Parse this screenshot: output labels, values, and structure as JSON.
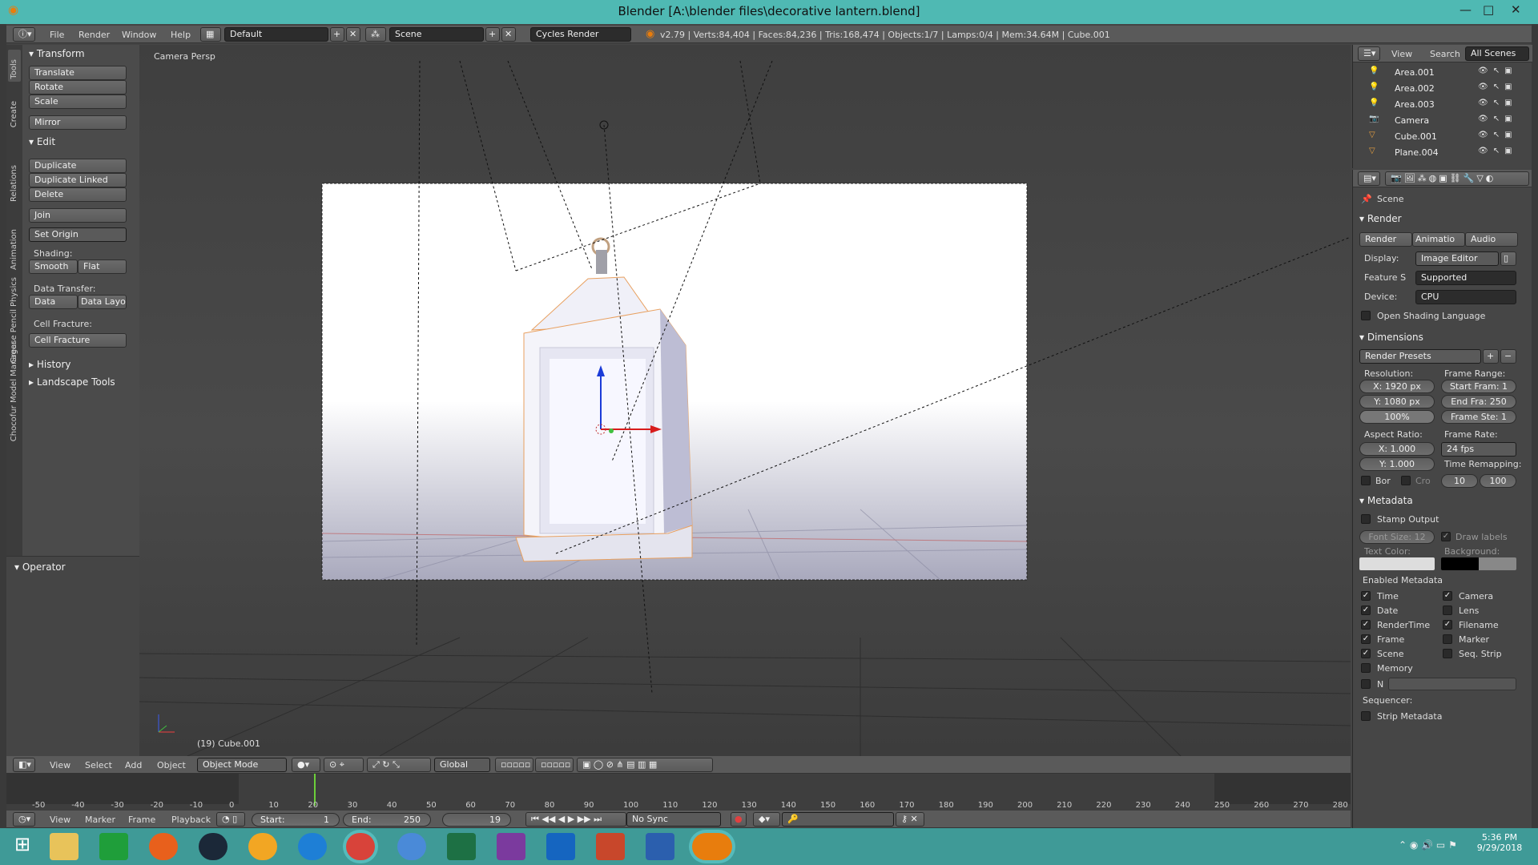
{
  "window": {
    "title": "Blender [A:\\blender files\\decorative lantern.blend]",
    "min": "—",
    "max": "□",
    "close": "✕"
  },
  "menu": {
    "file": "File",
    "render": "Render",
    "window": "Window",
    "help": "Help",
    "layout": "Default",
    "scene": "Scene",
    "engine": "Cycles Render",
    "stats": "v2.79 | Verts:84,404 | Faces:84,236 | Tris:168,474 | Objects:1/7 | Lamps:0/4 | Mem:34.64M | Cube.001"
  },
  "tabs": [
    "Tools",
    "Create",
    "Relations",
    "Animation",
    "Physics",
    "Grease Pencil",
    "Chocofur Model Manager"
  ],
  "toolshelf": {
    "transform": "Transform",
    "translate": "Translate",
    "rotate": "Rotate",
    "scale": "Scale",
    "mirror": "Mirror",
    "edit": "Edit",
    "duplicate": "Duplicate",
    "duplicate_linked": "Duplicate Linked",
    "delete": "Delete",
    "join": "Join",
    "set_origin": "Set Origin",
    "shading": "Shading:",
    "smooth": "Smooth",
    "flat": "Flat",
    "data_transfer": "Data Transfer:",
    "data": "Data",
    "data_layo": "Data Layo",
    "cell_fracture_lbl": "Cell Fracture:",
    "cell_fracture": "Cell Fracture",
    "history": "History",
    "landscape": "Landscape Tools",
    "operator": "Operator"
  },
  "viewport": {
    "label": "Camera Persp",
    "object": "(19) Cube.001"
  },
  "view_header": {
    "view": "View",
    "select": "Select",
    "add": "Add",
    "object": "Object",
    "mode": "Object Mode",
    "orient": "Global"
  },
  "timeline": {
    "ticks": [
      "-50",
      "-40",
      "-30",
      "-20",
      "-10",
      "0",
      "10",
      "20",
      "30",
      "40",
      "50",
      "60",
      "70",
      "80",
      "90",
      "100",
      "110",
      "120",
      "130",
      "140",
      "150",
      "160",
      "170",
      "180",
      "190",
      "200",
      "210",
      "220",
      "230",
      "240",
      "250",
      "260",
      "270",
      "280"
    ],
    "view": "View",
    "marker": "Marker",
    "frame": "Frame",
    "playback": "Playback",
    "start": "Start:",
    "start_val": "1",
    "end": "End:",
    "end_val": "250",
    "current": "19",
    "sync": "No Sync",
    "current_frame": 19
  },
  "outliner": {
    "view": "View",
    "search": "Search",
    "all_scenes": "All Scenes",
    "items": [
      "Area.001",
      "Area.002",
      "Area.003",
      "Camera",
      "Cube.001",
      "Plane.004"
    ]
  },
  "props": {
    "scene": "Scene",
    "render": "Render",
    "render_btn": "Render",
    "anim_btn": "Animatio",
    "audio_btn": "Audio",
    "display_lbl": "Display:",
    "display": "Image Editor",
    "feature_lbl": "Feature S",
    "feature": "Supported",
    "device_lbl": "Device:",
    "device": "CPU",
    "osl": "Open Shading Language",
    "dimensions": "Dimensions",
    "presets": "Render Presets",
    "resolution": "Resolution:",
    "res_x": "X:  1920 px",
    "res_y": "Y:  1080 px",
    "res_pct": "100%",
    "frame_range": "Frame Range:",
    "start_frame": "Start Fram: 1",
    "end_frame": "End Fra: 250",
    "frame_step": "Frame Ste: 1",
    "aspect": "Aspect Ratio:",
    "asp_x": "X:   1.000",
    "asp_y": "Y:   1.000",
    "frame_rate": "Frame Rate:",
    "fps": "24 fps",
    "time_remap": "Time Remapping:",
    "remap_old": "10",
    "remap_new": "100",
    "bor": "Bor",
    "cro": "Cro",
    "metadata": "Metadata",
    "stamp": "Stamp Output",
    "font_size": "Font Size: 12",
    "draw_labels": "Draw labels",
    "text_color": "Text Color:",
    "background": "Background:",
    "enabled": "Enabled Metadata",
    "m_time": "Time",
    "m_camera": "Camera",
    "m_date": "Date",
    "m_lens": "Lens",
    "m_rendertime": "RenderTime",
    "m_filename": "Filename",
    "m_frame": "Frame",
    "m_marker": "Marker",
    "m_scene": "Scene",
    "m_seqstrip": "Seq. Strip",
    "m_memory": "Memory",
    "m_n": "N",
    "sequencer": "Sequencer:",
    "strip_meta": "Strip Metadata"
  },
  "clock": {
    "time": "5:36 PM",
    "date": "9/29/2018"
  }
}
